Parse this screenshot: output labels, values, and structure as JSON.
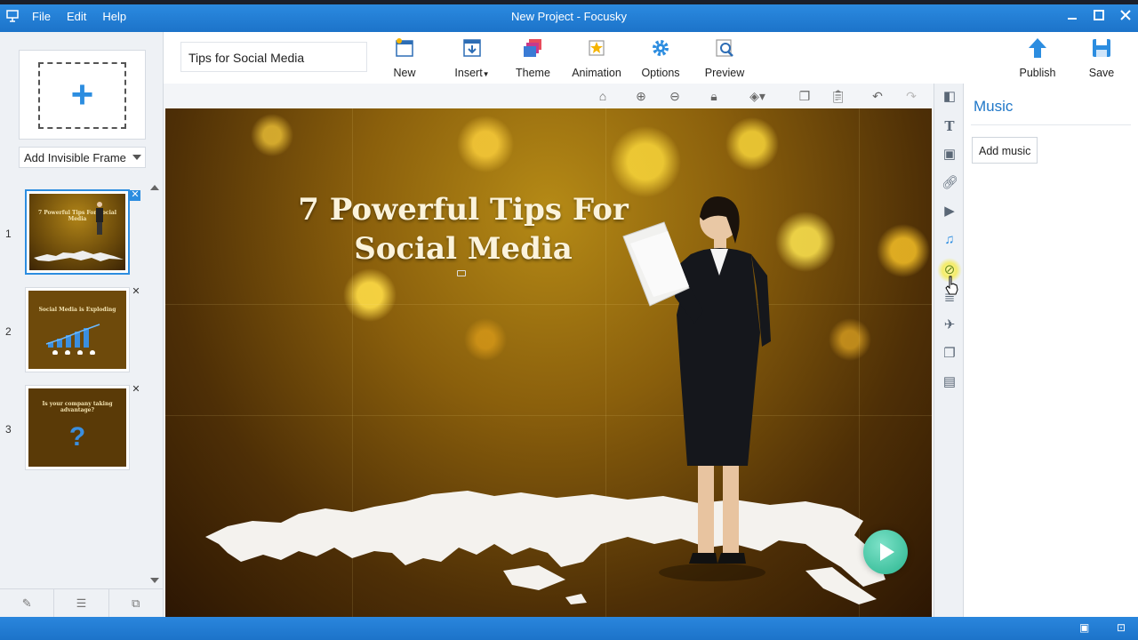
{
  "window": {
    "title": "New Project - Focusky",
    "menu": [
      "File",
      "Edit",
      "Help"
    ],
    "controls": [
      "minimize-icon",
      "maximize-icon",
      "close-icon"
    ]
  },
  "left_panel": {
    "add_frame_icon": "plus-icon",
    "frame_type": "Add Invisible Frame",
    "slides": [
      {
        "number": "1",
        "thumb_text": "7 Powerful Tips For Social Media"
      },
      {
        "number": "2",
        "thumb_text": "Social Media is Exploding"
      },
      {
        "number": "3",
        "thumb_text": "Is your company taking advantage?"
      }
    ]
  },
  "toolbar": {
    "project_title": "Tips for Social Media",
    "buttons": {
      "new": "New",
      "insert": "Insert",
      "theme": "Theme",
      "animation": "Animation",
      "options": "Options",
      "preview": "Preview",
      "publish": "Publish",
      "save": "Save"
    }
  },
  "canvas": {
    "title_line1": "7 Powerful Tips For",
    "title_line2": "Social Media"
  },
  "right_panel": {
    "title": "Music",
    "add_music": "Add music"
  },
  "colors": {
    "accent": "#2c8de0",
    "titlebar": "#1c73c9",
    "panel_title": "#1f77c8"
  }
}
